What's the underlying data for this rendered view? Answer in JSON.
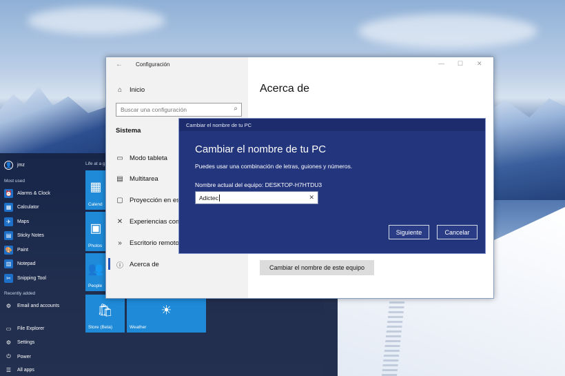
{
  "start_menu": {
    "user": "jmz",
    "most_used_header": "Most used",
    "most_used": [
      {
        "label": "Alarms & Clock",
        "icon": "alarm-clock-icon"
      },
      {
        "label": "Calculator",
        "icon": "calculator-icon"
      },
      {
        "label": "Maps",
        "icon": "map-icon"
      },
      {
        "label": "Sticky Notes",
        "icon": "sticky-notes-icon"
      },
      {
        "label": "Paint",
        "icon": "paint-icon"
      },
      {
        "label": "Notepad",
        "icon": "notepad-icon"
      },
      {
        "label": "Snipping Tool",
        "icon": "scissors-icon"
      }
    ],
    "recently_added_header": "Recently added",
    "recently_added": [
      {
        "label": "Email and accounts",
        "icon": "gear-icon"
      }
    ],
    "bottom": [
      {
        "label": "File Explorer",
        "icon": "folder-icon"
      },
      {
        "label": "Settings",
        "icon": "gear-icon"
      },
      {
        "label": "Power",
        "icon": "power-icon"
      },
      {
        "label": "All apps",
        "icon": "list-icon"
      }
    ],
    "tiles_header": "Life at a g",
    "tiles": [
      {
        "label": "Calend",
        "icon": "calendar-icon"
      },
      {
        "label": "Photos",
        "icon": "photos-icon"
      },
      {
        "label": "People",
        "icon": "people-icon"
      },
      {
        "label": "Store (Beta)",
        "icon": "store-icon"
      },
      {
        "label": "Weather",
        "icon": "sun-icon"
      }
    ]
  },
  "settings": {
    "title": "Configuración",
    "home": "Inicio",
    "search_placeholder": "Buscar una configuración",
    "section": "Sistema",
    "nav": [
      {
        "label": "Modo tableta",
        "icon": "tablet-mode-icon"
      },
      {
        "label": "Multitarea",
        "icon": "multitask-icon"
      },
      {
        "label": "Proyección en este equipo",
        "icon": "projection-icon"
      },
      {
        "label": "Experiencias compartidas",
        "icon": "shared-experiences-icon"
      },
      {
        "label": "Escritorio remoto",
        "icon": "remote-desktop-icon"
      },
      {
        "label": "Acerca de",
        "icon": "info-icon"
      }
    ],
    "main_title": "Acerca de",
    "rename_button": "Cambiar el nombre de este equipo"
  },
  "dialog": {
    "title_bar": "Cambiar el nombre de tu PC",
    "heading": "Cambiar el nombre de tu PC",
    "description": "Puedes usar una combinación de letras, guiones y números.",
    "current_name": "Nombre actual del equipo: DESKTOP-H7HTDU3",
    "input_value": "Adictec",
    "next_button": "Siguiente",
    "cancel_button": "Cancelar"
  }
}
